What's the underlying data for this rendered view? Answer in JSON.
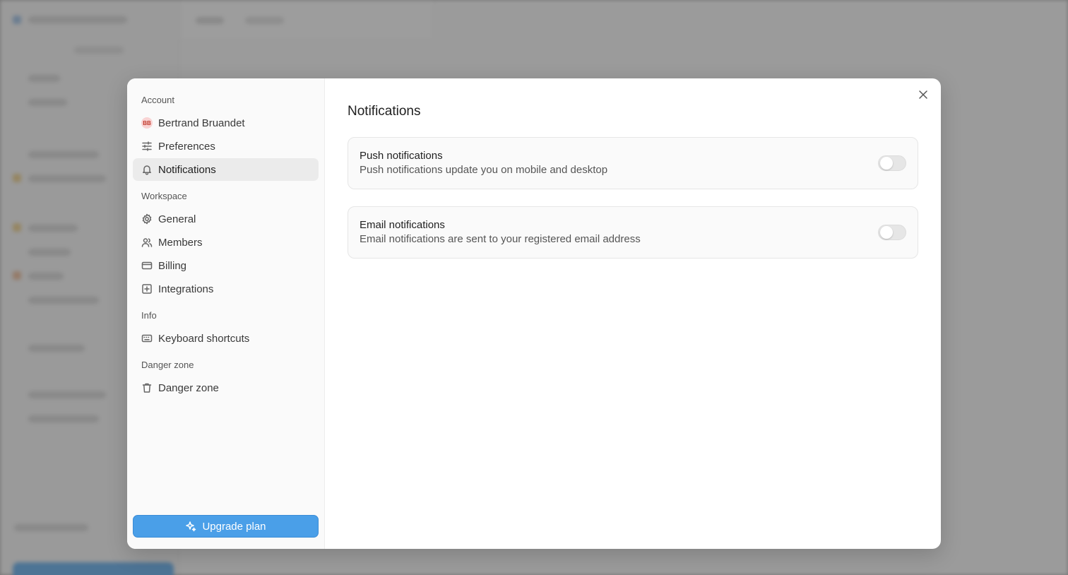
{
  "sidebar": {
    "sections": {
      "account": "Account",
      "workspace": "Workspace",
      "info": "Info",
      "danger": "Danger zone"
    },
    "user": {
      "initials": "BB",
      "name": "Bertrand Bruandet"
    },
    "items": {
      "preferences": "Preferences",
      "notifications": "Notifications",
      "general": "General",
      "members": "Members",
      "billing": "Billing",
      "integrations": "Integrations",
      "keyboard_shortcuts": "Keyboard shortcuts",
      "danger_zone": "Danger zone"
    },
    "active_item": "notifications",
    "upgrade_label": "Upgrade plan"
  },
  "main": {
    "title": "Notifications",
    "settings": [
      {
        "title": "Push notifications",
        "description": "Push notifications update you on mobile and desktop",
        "enabled": false
      },
      {
        "title": "Email notifications",
        "description": "Email notifications are sent to your registered email address",
        "enabled": false
      }
    ]
  },
  "colors": {
    "accent": "#4a9fe8",
    "avatar_bg": "#f9d3d3",
    "avatar_text": "#c0392b"
  },
  "icons": {
    "preferences": "sliders-icon",
    "notifications": "bell-icon",
    "general": "gear-icon",
    "members": "users-icon",
    "billing": "credit-card-icon",
    "integrations": "plus-square-icon",
    "keyboard_shortcuts": "keyboard-icon",
    "danger_zone": "trash-icon",
    "upgrade": "sparkle-icon",
    "close": "close-icon"
  }
}
